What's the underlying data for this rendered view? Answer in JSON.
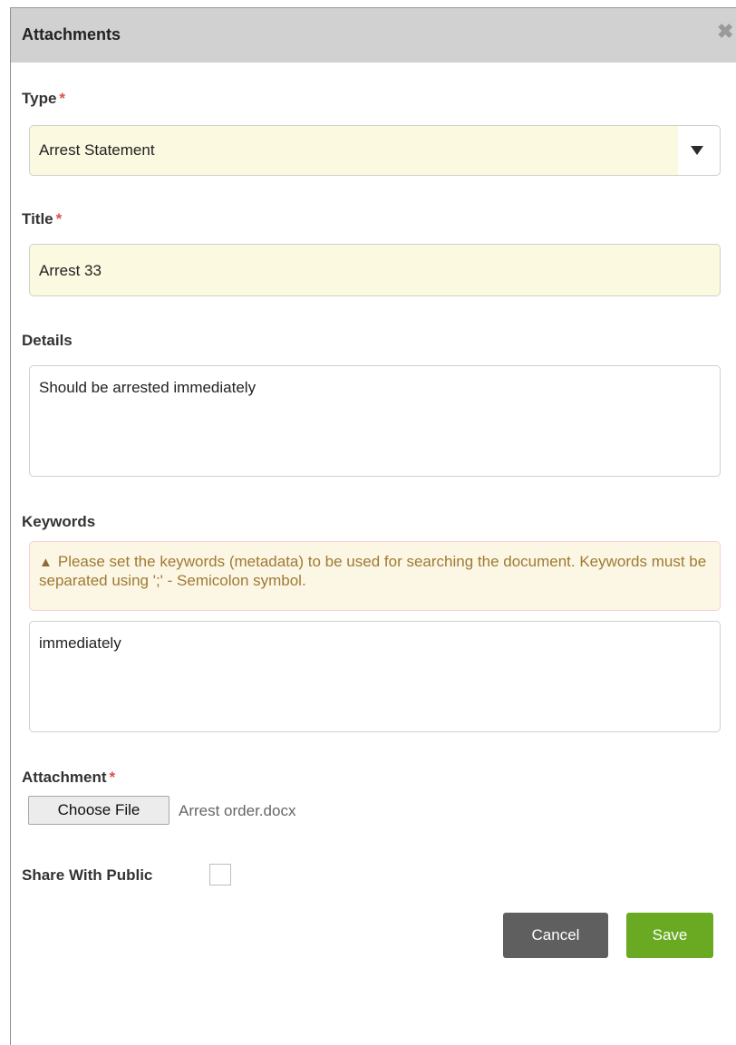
{
  "dialog": {
    "title": "Attachments",
    "close_glyph": "✖"
  },
  "form": {
    "required_marker": "*",
    "type": {
      "label": "Type",
      "value": "Arrest Statement"
    },
    "title": {
      "label": "Title",
      "value": "Arrest 33"
    },
    "details": {
      "label": "Details",
      "value": "Should be arrested immediately"
    },
    "keywords": {
      "label": "Keywords",
      "alert": "Please set the keywords (metadata) to be used for searching the document. Keywords must be separated using ';' - Semicolon symbol.",
      "value": "immediately"
    },
    "attachment": {
      "label": "Attachment",
      "button_label": "Choose File",
      "file_name": "Arrest order.docx"
    },
    "share": {
      "label": "Share With Public",
      "checked": false
    }
  },
  "actions": {
    "cancel_label": "Cancel",
    "save_label": "Save"
  },
  "icons": {
    "close": "close-icon",
    "dropdown": "caret-down-icon",
    "warning": "warning-icon"
  },
  "colors": {
    "header_bg": "#d1d1d1",
    "required": "#d9534f",
    "filled_field_bg": "#fbf9df",
    "alert_bg": "#fcf6e4",
    "alert_text": "#a07a33",
    "cancel_bg": "#5f5f5f",
    "save_bg": "#6aaa23"
  }
}
